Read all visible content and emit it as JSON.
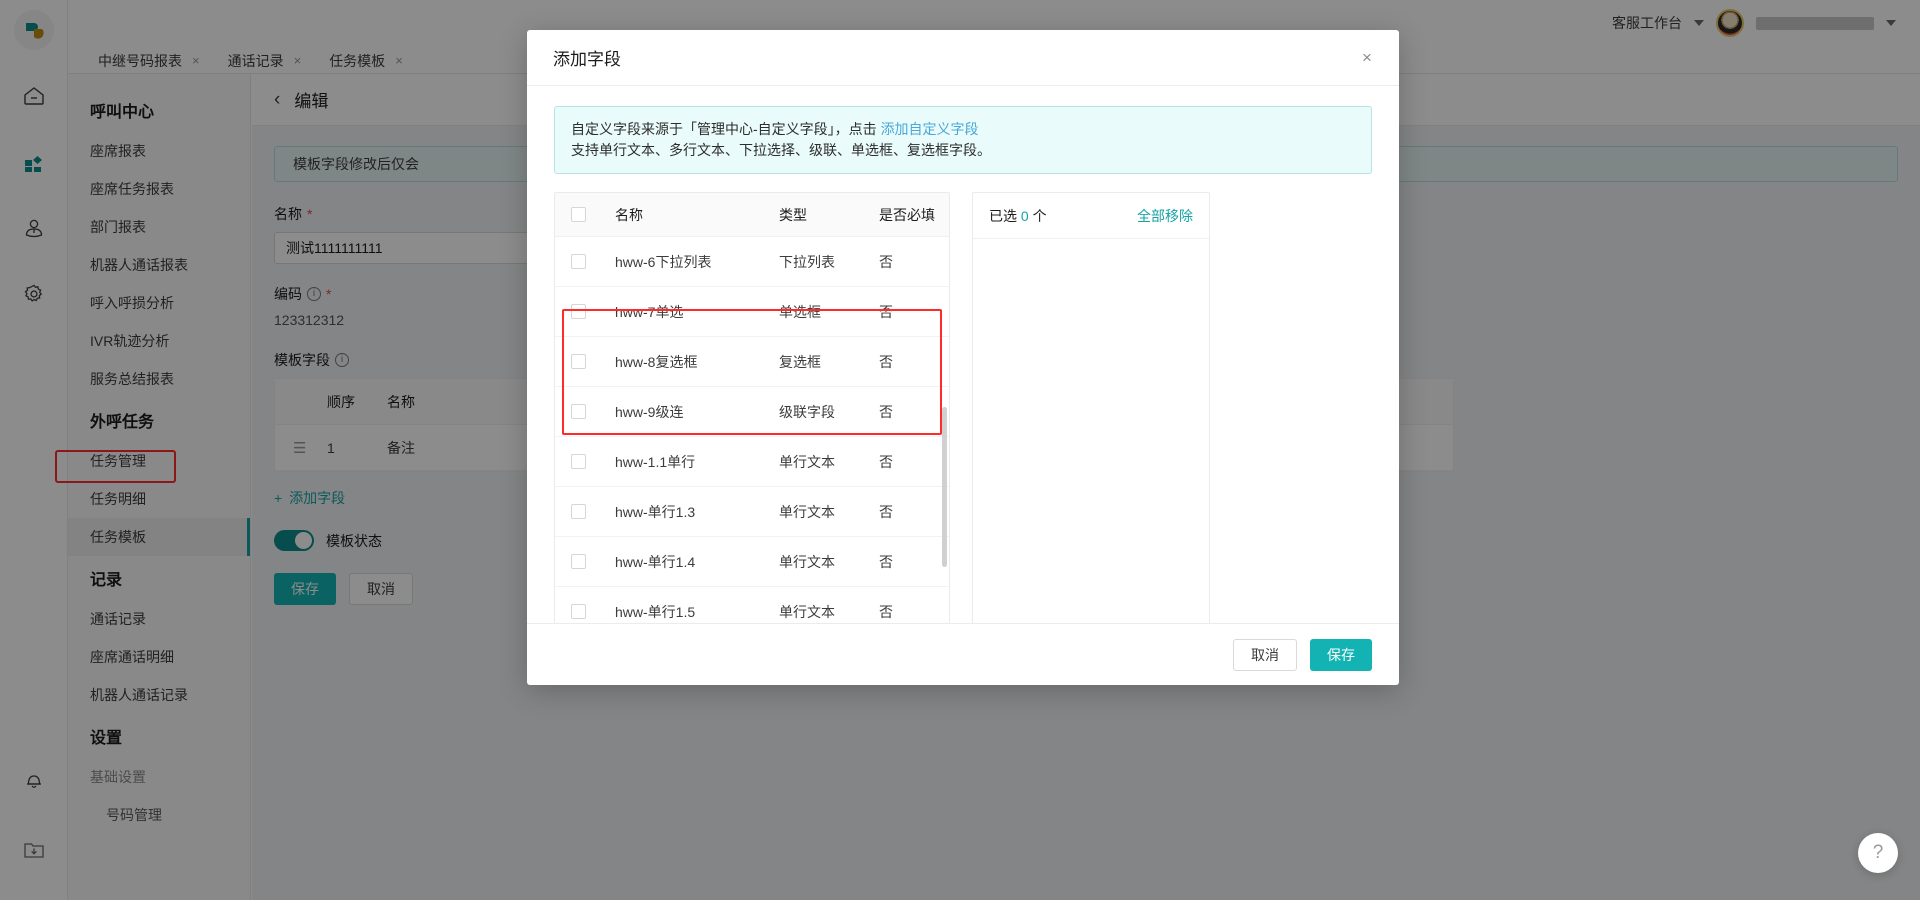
{
  "topbar": {
    "workbench_label": "客服工作台",
    "tabs": [
      {
        "label": "中继号码报表",
        "close": "×"
      },
      {
        "label": "通话记录",
        "close": "×"
      },
      {
        "label": "任务模板",
        "close": "×"
      }
    ]
  },
  "rail": {
    "icons": [
      "logo-icon",
      "home-icon",
      "apps-icon",
      "user-icon",
      "gear-icon",
      "bell-icon",
      "download-folder-icon"
    ]
  },
  "sidebar": {
    "groups": [
      {
        "title": "呼叫中心",
        "items": [
          {
            "label": "座席报表"
          },
          {
            "label": "座席任务报表"
          },
          {
            "label": "部门报表"
          },
          {
            "label": "机器人通话报表"
          },
          {
            "label": "呼入呼损分析"
          },
          {
            "label": "IVR轨迹分析"
          },
          {
            "label": "服务总结报表"
          }
        ]
      },
      {
        "title": "外呼任务",
        "items": [
          {
            "label": "任务管理"
          },
          {
            "label": "任务明细"
          },
          {
            "label": "任务模板"
          }
        ]
      },
      {
        "title": "记录",
        "items": [
          {
            "label": "通话记录"
          },
          {
            "label": "座席通话明细"
          },
          {
            "label": "机器人通话记录"
          }
        ]
      },
      {
        "title": "设置",
        "items": [
          {
            "label": "基础设置"
          },
          {
            "label": "号码管理"
          }
        ]
      }
    ]
  },
  "page": {
    "back_icon": "‹",
    "title": "编辑",
    "notice": "模板字段修改后仅会",
    "name_label": "名称",
    "name_required": "*",
    "name_value": "测试1111111111",
    "code_label": "编码",
    "code_required": "*",
    "code_value": "123312312",
    "fields_label": "模板字段",
    "table": {
      "headers": [
        "顺序",
        "名称"
      ],
      "rows": [
        {
          "order": "1",
          "name": "备注"
        }
      ]
    },
    "add_field_label": "添加字段",
    "add_field_icon": "+",
    "toggle_label": "模板状态",
    "save_label": "保存",
    "cancel_label": "取消"
  },
  "modal": {
    "title": "添加字段",
    "close_icon": "×",
    "banner": {
      "line1_pre": "自定义字段来源于「管理中心-自定义字段」，点击 ",
      "line1_link": "添加自定义字段",
      "line2": "支持单行文本、多行文本、下拉选择、级联、单选框、复选框字段。"
    },
    "list": {
      "headers": [
        "名称",
        "类型",
        "是否必填"
      ],
      "rows": [
        {
          "name": "hww-6下拉列表",
          "type": "下拉列表",
          "required": "否"
        },
        {
          "name": "hww-7单选",
          "type": "单选框",
          "required": "否"
        },
        {
          "name": "hww-8复选框",
          "type": "复选框",
          "required": "否"
        },
        {
          "name": "hww-9级连",
          "type": "级联字段",
          "required": "否"
        },
        {
          "name": "hww-1.1单行",
          "type": "单行文本",
          "required": "否"
        },
        {
          "name": "hww-单行1.3",
          "type": "单行文本",
          "required": "否"
        },
        {
          "name": "hww-单行1.4",
          "type": "单行文本",
          "required": "否"
        },
        {
          "name": "hww-单行1.5",
          "type": "单行文本",
          "required": "否"
        }
      ]
    },
    "selected": {
      "prefix": "已选",
      "count": "0",
      "suffix": "个",
      "clear_label": "全部移除"
    },
    "cancel_label": "取消",
    "save_label": "保存"
  },
  "help": {
    "icon": "?"
  },
  "colors": {
    "accent": "#17a3a3",
    "primary_button": "#14b3b3",
    "highlight": "#ff2b2b",
    "link": "#4aa8d8"
  }
}
